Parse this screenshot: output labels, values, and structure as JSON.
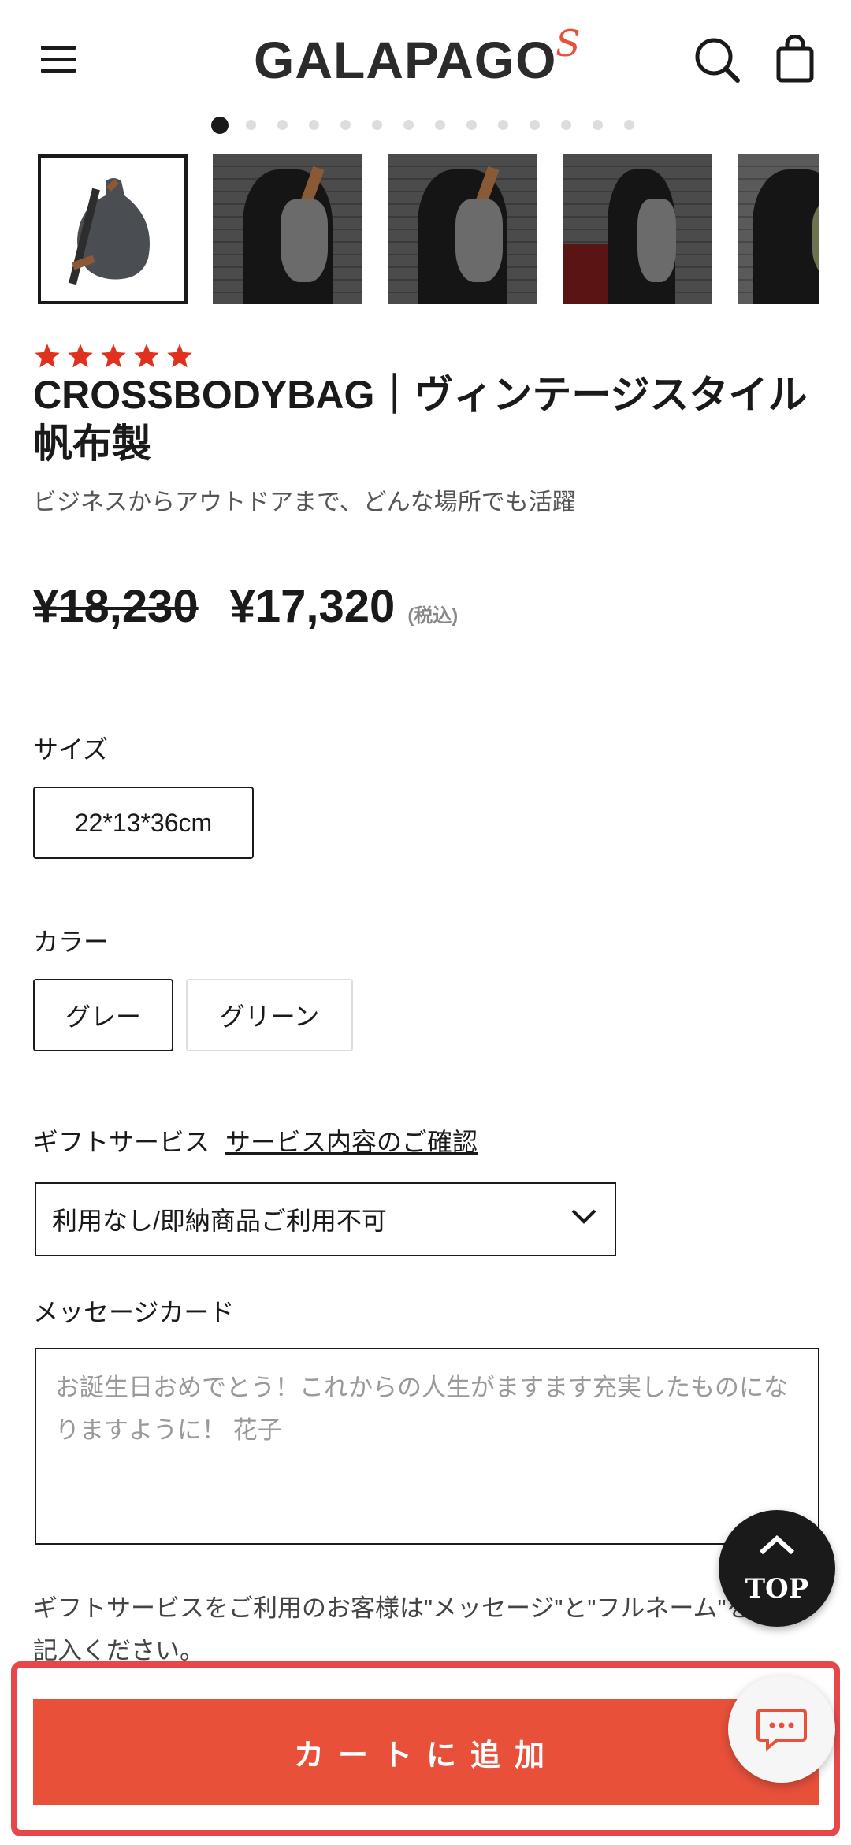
{
  "header": {
    "logo_text": "GALAPAGO",
    "logo_mark": "S",
    "icons": [
      "menu-icon",
      "search-icon",
      "shopping-bag-icon"
    ]
  },
  "gallery": {
    "dot_count": 14,
    "active_dot": 0,
    "thumbnails": [
      "thumb-1",
      "thumb-2",
      "thumb-3",
      "thumb-4",
      "thumb-5"
    ],
    "selected_thumbnail": 0
  },
  "product": {
    "rating": 5,
    "title": "CROSSBODYBAG｜ヴィンテージスタイル 帆布製",
    "subtitle": "ビジネスからアウトドアまで、どんな場所でも活躍",
    "old_price": "¥18,230",
    "new_price": "¥17,320",
    "tax_note": "(税込)"
  },
  "size": {
    "label": "サイズ",
    "options": [
      "22*13*36cm"
    ],
    "selected": 0
  },
  "color": {
    "label": "カラー",
    "options": [
      "グレー",
      "グリーン"
    ],
    "selected": 0
  },
  "gift": {
    "label": "ギフトサービス",
    "link": "サービス内容のご確認",
    "select_value": "利用なし/即納商品ご利用不可"
  },
  "message": {
    "label": "メッセージカード",
    "placeholder": "お誕生日おめでとう！これからの人生がますます充実したものになりますように！ 花子",
    "note": "ギフトサービスをご利用のお客様は\"メッセージ\"と\"フルネーム\"をご記入ください。"
  },
  "actions": {
    "top_label": "TOP",
    "cart_label": "カートに追加"
  },
  "colors": {
    "accent": "#e8503a",
    "star": "#e0301e",
    "highlight_border": "#e8474a"
  }
}
